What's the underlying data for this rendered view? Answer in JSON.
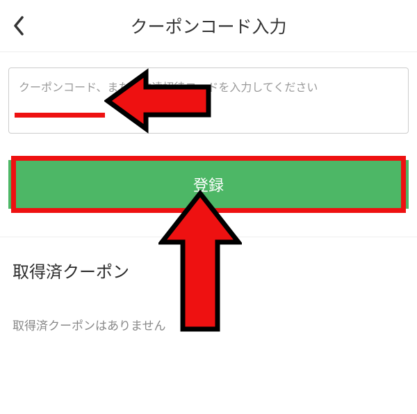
{
  "header": {
    "title": "クーポンコード入力"
  },
  "form": {
    "placeholder": "クーポンコード、または友達招待コードを入力してください",
    "submit_label": "登録"
  },
  "coupons": {
    "title": "取得済クーポン",
    "empty_text": "取得済クーポンはありません"
  }
}
